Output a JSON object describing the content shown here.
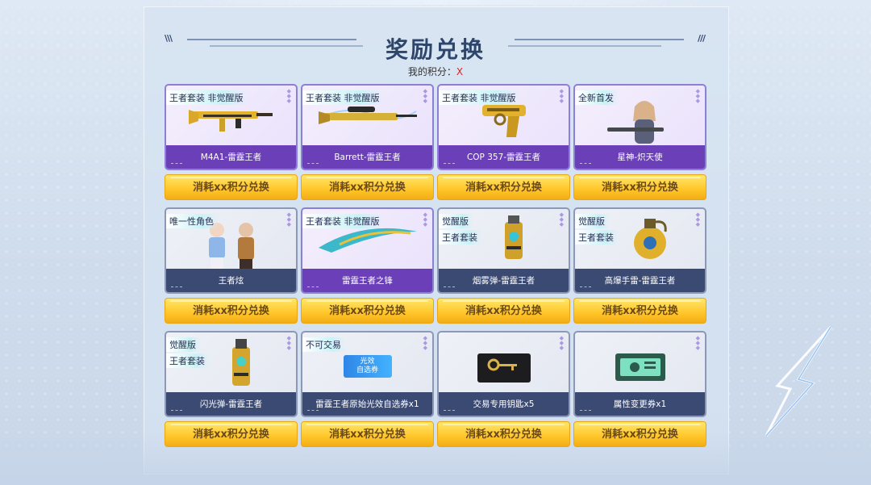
{
  "header": {
    "title": "奖励兑换",
    "score_label": "我的积分：",
    "score_value": "X"
  },
  "button_label": "消耗xx积分兑换",
  "colors": {
    "accent_purple": "#6a3fb8",
    "accent_navy": "#3b4a72",
    "button_yellow": "#ffc529",
    "score_red": "#e02020"
  },
  "items": [
    {
      "tags": [
        "王者套装 非觉醒版"
      ],
      "name": "M4A1-雷霆王者",
      "icon": "rifle-icon",
      "style": "purple"
    },
    {
      "tags": [
        "王者套装 非觉醒版"
      ],
      "name": "Barrett-雷霆王者",
      "icon": "sniper-rifle-icon",
      "style": "purple"
    },
    {
      "tags": [
        "王者套装 非觉醒版"
      ],
      "name": "COP 357-雷霆王者",
      "icon": "pistol-icon",
      "style": "purple"
    },
    {
      "tags": [
        "全新首发"
      ],
      "name": "星神-炽天使",
      "icon": "character-icon",
      "style": "purple"
    },
    {
      "tags": [
        "唯一性角色"
      ],
      "name": "王者炫",
      "icon": "characters-icon",
      "style": "grey"
    },
    {
      "tags": [
        "王者套装 非觉醒版"
      ],
      "name": "雷霆王者之锋",
      "icon": "blade-icon",
      "style": "purple"
    },
    {
      "tags": [
        "觉醒版",
        "王者套装"
      ],
      "name": "烟雾弹-雷霆王者",
      "icon": "smoke-grenade-icon",
      "style": "grey"
    },
    {
      "tags": [
        "觉醒版",
        "王者套装"
      ],
      "name": "高爆手雷-雷霆王者",
      "icon": "frag-grenade-icon",
      "style": "grey"
    },
    {
      "tags": [
        "觉醒版",
        "王者套装"
      ],
      "name": "闪光弹-雷霆王者",
      "icon": "flash-grenade-icon",
      "style": "grey"
    },
    {
      "tags": [
        "不可交易"
      ],
      "name": "雷霆王者原始光效自选券x1",
      "icon": "ticket-icon",
      "ticket_text": [
        "光效",
        "自选券"
      ],
      "style": "grey"
    },
    {
      "tags": [],
      "name": "交易专用钥匙x5",
      "icon": "key-icon",
      "style": "grey"
    },
    {
      "tags": [],
      "name": "属性变更券x1",
      "icon": "coupon-icon",
      "style": "grey"
    }
  ]
}
